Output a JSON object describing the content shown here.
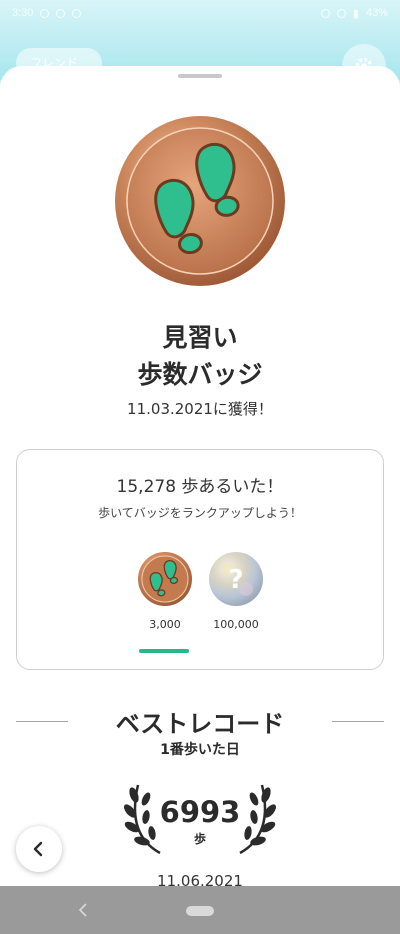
{
  "status_bar": {
    "time": "3:30",
    "battery": "43%"
  },
  "header": {
    "pill_label": "フレンド"
  },
  "badge": {
    "name_line1": "見習い",
    "name_line2": "歩数バッジ",
    "obtained": "11.03.2021に獲得！"
  },
  "progress_card": {
    "steps_text": "15,278 歩あるいた！",
    "rankup_text": "歩いてバッジをランクアップしよう！",
    "levels": [
      {
        "label": "3,000",
        "unlocked": true
      },
      {
        "label": "100,000",
        "unlocked": false
      }
    ],
    "accent_color": "#2bb58a"
  },
  "best_record": {
    "title": "ベストレコード",
    "subtitle": "1番歩いた日",
    "value": "6993",
    "unit": "歩",
    "date": "11.06.2021"
  },
  "colors": {
    "bronze": "#c98055",
    "footprint": "#2fbf8f"
  }
}
